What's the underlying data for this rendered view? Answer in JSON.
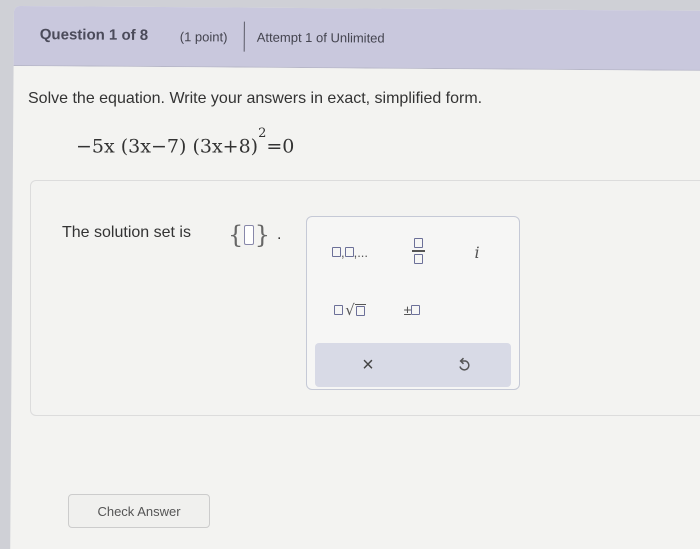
{
  "header": {
    "question_label": "Question 1 of 8",
    "points": "(1 point)",
    "attempt": "Attempt 1 of Unlimited"
  },
  "question": {
    "prompt": "Solve the equation. Write your answers in exact, simplified form.",
    "equation_main": "−5x (3x−7) (3x+8)",
    "equation_exponent": "2",
    "equation_rhs": "=0"
  },
  "answer": {
    "label": "The solution set is",
    "open_brace": "{",
    "close_brace": "}",
    "terminator": "."
  },
  "palette": {
    "list_ellipsis": ",...",
    "imaginary": "i",
    "plus_minus": "±",
    "clear": "×"
  },
  "footer": {
    "check_button": "Check Answer"
  }
}
